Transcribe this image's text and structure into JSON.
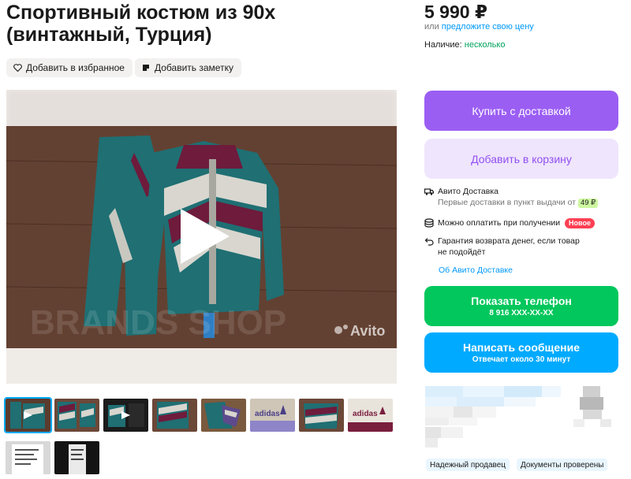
{
  "listing": {
    "title_line1": "Спортивный костюм из 90х",
    "title_line2": "(винтажный, Турция)",
    "favorite_label": "Добавить в избранное",
    "note_label": "Добавить заметку"
  },
  "media": {
    "watermark_brand": "BRANDS SHOP",
    "watermark_avito": "Avito",
    "icons": [
      "play-icon"
    ],
    "thumbnail_count": 10,
    "selected_thumbnail": 1
  },
  "pricing": {
    "price": "5 990 ₽",
    "or_text": "или",
    "offer_link": "предложите свою цену",
    "availability_label": "Наличие:",
    "availability_value": "несколько"
  },
  "actions": {
    "buy_delivery": "Купить с доставкой",
    "add_cart": "Добавить в корзину",
    "show_phone": "Показать телефон",
    "phone_masked": "8 916 XXX-XX-XX",
    "write_message": "Написать сообщение",
    "reply_time": "Отвечает около 30 минут"
  },
  "delivery": {
    "title": "Авито Доставка",
    "first_delivery": "Первые доставки в пункт выдачи от",
    "first_delivery_price": "49 ₽",
    "pay_on_receipt": "Можно оплатить при получении",
    "new_badge": "Новое",
    "guarantee_line1": "Гарантия возврата денег, если товар",
    "guarantee_line2": "не подойдёт",
    "about_link": "Об Авито Доставке"
  },
  "seller": {
    "badges": [
      "Надежный продавец",
      "Документы проверены"
    ]
  },
  "colors": {
    "buy": "#9b5ef3",
    "cart_bg": "#efe5fd",
    "phone": "#02c75c",
    "message": "#00aaff",
    "link": "#0099f7",
    "availability": "#02a35c",
    "new_badge": "#ff4053"
  }
}
